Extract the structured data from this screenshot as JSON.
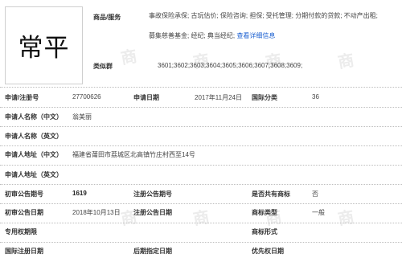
{
  "logo_text": "常平",
  "goods": {
    "label": "商品/服务",
    "line1": "事故保险承保; 古玩估价; 保险咨询; 担保; 受托管理; 分期付款的贷款; 不动产出租;",
    "line2": "募集慈善基金; 经纪; 典当经纪;",
    "more": "查看详细信息"
  },
  "similar": {
    "label": "类似群",
    "value": "3601;3602;3603;3604;3605;3606;3607;3608;3609;"
  },
  "rows": {
    "reg_no_label": "申请/注册号",
    "reg_no": "27700626",
    "app_date_label": "申请日期",
    "app_date": "2017年11月24日",
    "intl_class_label": "国际分类",
    "intl_class": "36",
    "name_cn_label": "申请人名称（中文）",
    "name_cn": "翁美丽",
    "name_en_label": "申请人名称（英文）",
    "addr_cn_label": "申请人地址（中文）",
    "addr_cn": "福建省莆田市荔城区北高镇竹庄村西至14号",
    "addr_en_label": "申请人地址（英文）",
    "prelim_no_label": "初审公告期号",
    "prelim_no": "1619",
    "reg_pub_no_label": "注册公告期号",
    "shared_label": "是否共有商标",
    "shared": "否",
    "prelim_date_label": "初审公告日期",
    "prelim_date": "2018年10月13日",
    "reg_pub_date_label": "注册公告日期",
    "mark_type_label": "商标类型",
    "mark_type": "一般",
    "exclusive_label": "专用权期限",
    "mark_form_label": "商标形式",
    "intl_reg_date_label": "国际注册日期",
    "later_date_label": "后期指定日期",
    "priority_date_label": "优先权日期"
  }
}
